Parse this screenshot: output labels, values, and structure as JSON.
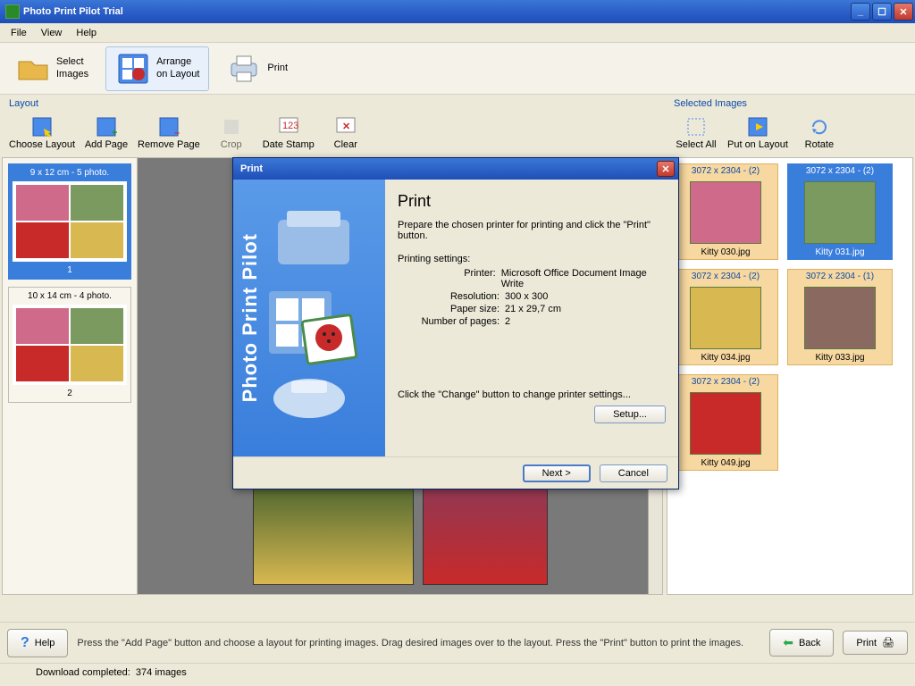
{
  "title": "Photo Print Pilot Trial",
  "menu": {
    "file": "File",
    "view": "View",
    "help": "Help"
  },
  "maintb": {
    "select_images": "Select\nImages",
    "arrange": "Arrange\non Layout",
    "print": "Print"
  },
  "layout": {
    "title": "Layout",
    "choose": "Choose Layout",
    "add_page": "Add Page",
    "remove_page": "Remove Page",
    "crop": "Crop",
    "date_stamp": "Date Stamp",
    "clear": "Clear",
    "thumbs": [
      {
        "hdr": "9 x 12 cm - 5 photo.",
        "page": "1",
        "selected": true
      },
      {
        "hdr": "10 x 14 cm - 4 photo.",
        "page": "2",
        "selected": false
      }
    ]
  },
  "selected": {
    "title": "Selected Images",
    "select_all": "Select All",
    "put_on_layout": "Put on Layout",
    "rotate": "Rotate",
    "items": [
      {
        "dim": "3072 x 2304 - (2)",
        "name": "Kitty 030.jpg",
        "sel": false,
        "color": "#d06a8a"
      },
      {
        "dim": "3072 x 2304 - (2)",
        "name": "Kitty 031.jpg",
        "sel": true,
        "color": "#7a9a60"
      },
      {
        "dim": "3072 x 2304 - (2)",
        "name": "Kitty 034.jpg",
        "sel": false,
        "color": "#d8b850"
      },
      {
        "dim": "3072 x 2304 - (1)",
        "name": "Kitty 033.jpg",
        "sel": false,
        "color": "#8a6a60"
      },
      {
        "dim": "3072 x 2304 - (2)",
        "name": "Kitty 049.jpg",
        "sel": false,
        "color": "#c82a2a"
      }
    ]
  },
  "hint": {
    "help": "Help",
    "text": "Press the \"Add Page\" button and choose a layout for printing images. Drag desired images over to the layout. Press the \"Print\" button to print the images.",
    "back": "Back",
    "print": "Print"
  },
  "status": {
    "label": "Download completed:",
    "count": "374 images"
  },
  "dialog": {
    "title": "Print",
    "sidebar": "Photo Print Pilot",
    "heading": "Print",
    "intro": "Prepare the chosen printer for printing and click the \"Print\" button.",
    "settings_label": "Printing settings:",
    "printer_k": "Printer:",
    "printer_v": "Microsoft Office Document Image Write",
    "res_k": "Resolution:",
    "res_v": "300 x 300",
    "paper_k": "Paper size:",
    "paper_v": "21 x 29,7 cm",
    "pages_k": "Number of pages:",
    "pages_v": "2",
    "change_hint": "Click the \"Change\" button to change printer settings...",
    "setup": "Setup...",
    "next": "Next >",
    "cancel": "Cancel"
  }
}
